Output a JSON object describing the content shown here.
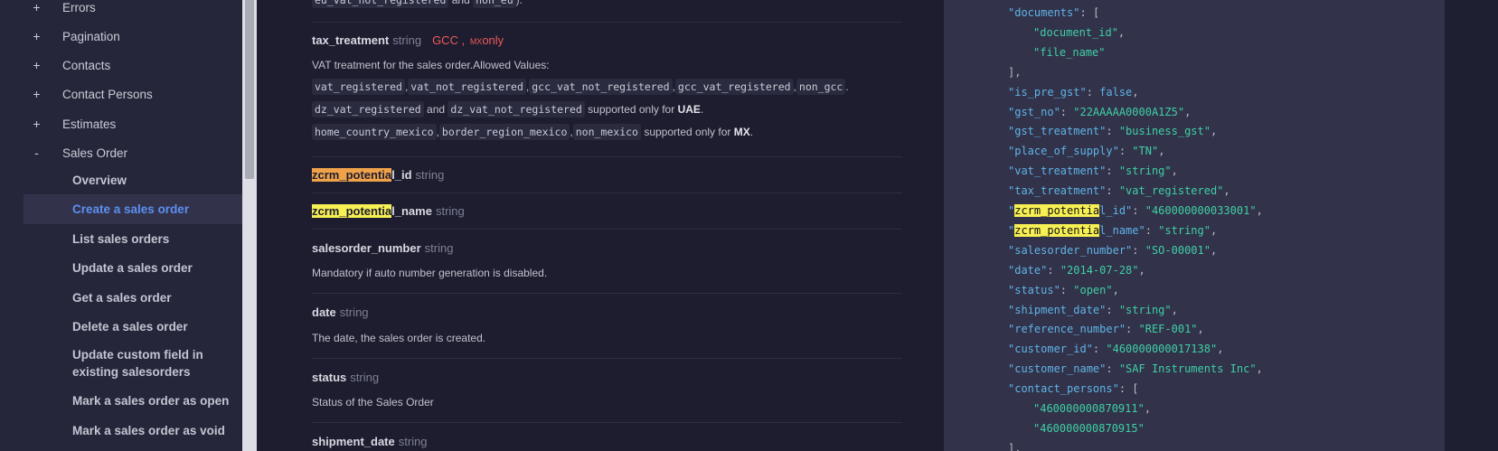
{
  "sidebar": {
    "top_items": [
      {
        "sign": "+",
        "label": "Errors"
      },
      {
        "sign": "+",
        "label": "Pagination"
      },
      {
        "sign": "+",
        "label": "Contacts"
      },
      {
        "sign": "+",
        "label": "Contact Persons"
      },
      {
        "sign": "+",
        "label": "Estimates"
      },
      {
        "sign": "-",
        "label": "Sales Order"
      }
    ],
    "sub_items": [
      "Overview",
      "Create a sales order",
      "List sales orders",
      "Update a sales order",
      "Get a sales order",
      "Delete a sales order",
      "Update custom field in existing salesorders",
      "Mark a sales order as open",
      "Mark a sales order as void"
    ],
    "active_sub_item": "Create a sales order"
  },
  "main": {
    "top_fragment": {
      "code1": "eu_vat_not_registered",
      "mid": " and ",
      "code2": "non_eu",
      "tail": ")."
    },
    "tax_treatment": {
      "name": "tax_treatment",
      "type": "string",
      "badge_gcc": "GCC ,",
      "badge_mx_icon": "MX",
      "badge_mx_text": "only",
      "desc": "VAT treatment for the sales order.Allowed Values:",
      "values_row1": [
        "vat_registered",
        "vat_not_registered",
        "gcc_vat_not_registered",
        "gcc_vat_registered",
        "non_gcc"
      ],
      "row2_codes": [
        "dz_vat_registered",
        "dz_vat_not_registered"
      ],
      "row2_and": "and",
      "row2_supported": "supported only for",
      "row2_region": "UAE",
      "row3_codes": [
        "home_country_mexico",
        "border_region_mexico",
        "non_mexico"
      ],
      "row3_supported": "supported only for",
      "row3_region": "MX"
    },
    "zcrm_potential_id": {
      "hl": "zcrm_potentia",
      "rest": "l_id",
      "type": "string"
    },
    "zcrm_potential_name": {
      "hl": "zcrm_potentia",
      "rest": "l_name",
      "type": "string"
    },
    "salesorder_number": {
      "name": "salesorder_number",
      "type": "string",
      "desc": "Mandatory if auto number generation is disabled."
    },
    "date": {
      "name": "date",
      "type": "string",
      "desc": "The date, the sales order is created."
    },
    "status": {
      "name": "status",
      "type": "string",
      "desc": "Status of the Sales Order"
    },
    "shipment_date": {
      "name": "shipment_date",
      "type": "string"
    }
  },
  "code_panel": {
    "lines": [
      {
        "indent": 0,
        "key": "documents",
        "open": "["
      },
      {
        "indent": 1,
        "str": "document_id",
        "comma": true
      },
      {
        "indent": 1,
        "str": "file_name"
      },
      {
        "indent": 0,
        "close": "],"
      },
      {
        "indent": 0,
        "key": "is_pre_gst",
        "bool": "false"
      },
      {
        "indent": 0,
        "key": "gst_no",
        "val": "22AAAAA0000A1Z5"
      },
      {
        "indent": 0,
        "key": "gst_treatment",
        "val": "business_gst"
      },
      {
        "indent": 0,
        "key": "place_of_supply",
        "val": "TN"
      },
      {
        "indent": 0,
        "key": "vat_treatment",
        "val": "string"
      },
      {
        "indent": 0,
        "key": "tax_treatment",
        "val": "vat_registered"
      },
      {
        "indent": 0,
        "key_hl": "zcrm_potentia",
        "key_rest": "l_id",
        "val": "460000000033001"
      },
      {
        "indent": 0,
        "key_hl": "zcrm_potentia",
        "key_rest": "l_name",
        "val": "string"
      },
      {
        "indent": 0,
        "key": "salesorder_number",
        "val": "SO-00001"
      },
      {
        "indent": 0,
        "key": "date",
        "val": "2014-07-28"
      },
      {
        "indent": 0,
        "key": "status",
        "val": "open"
      },
      {
        "indent": 0,
        "key": "shipment_date",
        "val": "string"
      },
      {
        "indent": 0,
        "key": "reference_number",
        "val": "REF-001"
      },
      {
        "indent": 0,
        "key": "customer_id",
        "val": "460000000017138"
      },
      {
        "indent": 0,
        "key": "customer_name",
        "val": "SAF Instruments Inc"
      },
      {
        "indent": 0,
        "key": "contact_persons",
        "open": "["
      },
      {
        "indent": 1,
        "str": "460000000870911",
        "comma": true
      },
      {
        "indent": 1,
        "str": "460000000870915"
      },
      {
        "indent": 0,
        "close": "],"
      }
    ]
  }
}
